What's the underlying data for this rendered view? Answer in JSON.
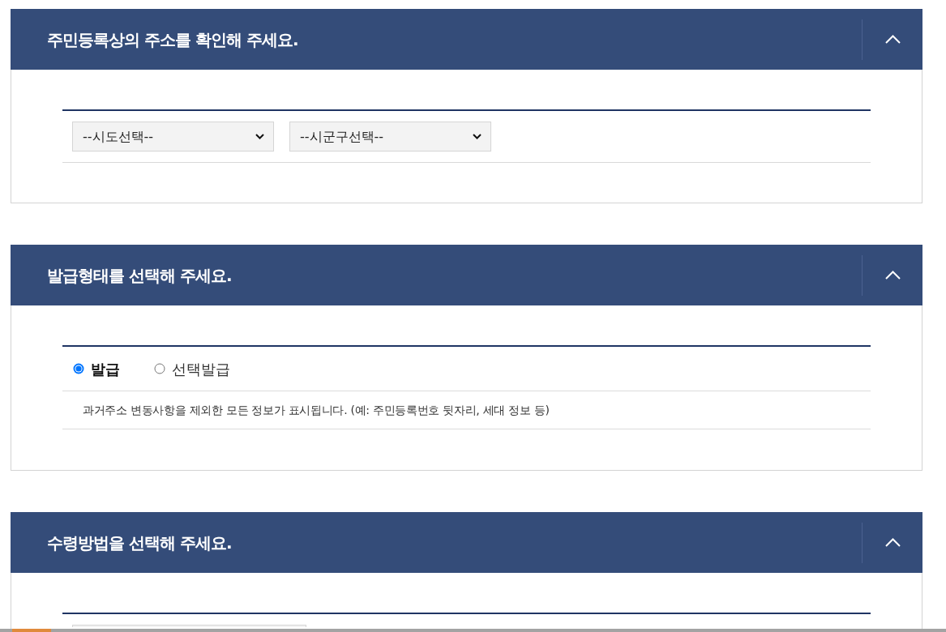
{
  "sections": [
    {
      "title": "주민등록상의 주소를 확인해 주세요.",
      "expanded": true,
      "body": {
        "kind": "dropdowns",
        "dropdowns": [
          {
            "value": "--시도선택--"
          },
          {
            "value": "--시군구선택--"
          }
        ]
      }
    },
    {
      "title": "발급형태를 선택해 주세요.",
      "expanded": true,
      "body": {
        "kind": "radios",
        "options": [
          {
            "label": "발급",
            "selected": true
          },
          {
            "label": "선택발급",
            "selected": false
          }
        ],
        "description": "과거주소 변동사항을 제외한 모든 정보가 표시됩니다. (예: 주민등록번호 뒷자리, 세대 정보 등)"
      }
    },
    {
      "title": "수령방법을 선택해 주세요.",
      "expanded": true,
      "body": {
        "kind": "cut_off_dropdown"
      }
    }
  ]
}
